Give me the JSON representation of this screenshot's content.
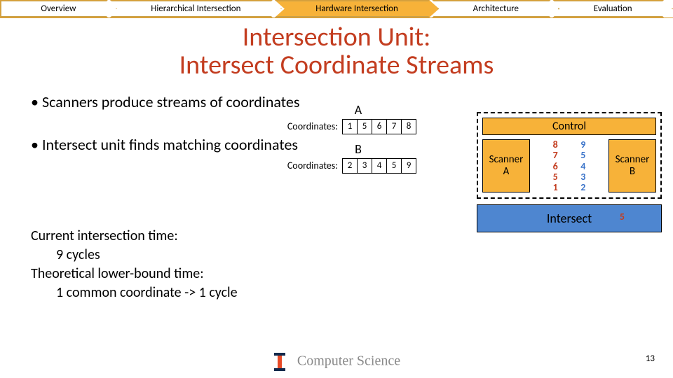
{
  "nav": {
    "items": [
      "Overview",
      "Hierarchical Intersection",
      "Hardware Intersection",
      "Architecture",
      "Evaluation"
    ],
    "active_index": 2
  },
  "title_line1": "Intersection Unit:",
  "title_line2": "Intersect Coordinate Streams",
  "bullets": [
    "Scanners produce streams of coordinates",
    "Intersect unit finds matching coordinates"
  ],
  "streams": {
    "coord_word": "Coordinates:",
    "A": {
      "label": "A",
      "values": [
        "1",
        "5",
        "6",
        "7",
        "8"
      ]
    },
    "B": {
      "label": "B",
      "values": [
        "2",
        "3",
        "4",
        "5",
        "9"
      ]
    }
  },
  "diagram": {
    "control": "Control",
    "scannerA": "Scanner\nA",
    "scannerB": "Scanner\nB",
    "stackA": [
      "8",
      "7",
      "6",
      "5",
      "1"
    ],
    "stackB": [
      "9",
      "5",
      "4",
      "3",
      "2"
    ],
    "intersect": "Intersect",
    "intersect_out": "5"
  },
  "timing": {
    "l1": "Current intersection time:",
    "l2": "9 cycles",
    "l3": "Theoretical lower-bound time:",
    "l4": "1 common coordinate -> 1 cycle"
  },
  "footer": "Computer Science",
  "page": "13"
}
